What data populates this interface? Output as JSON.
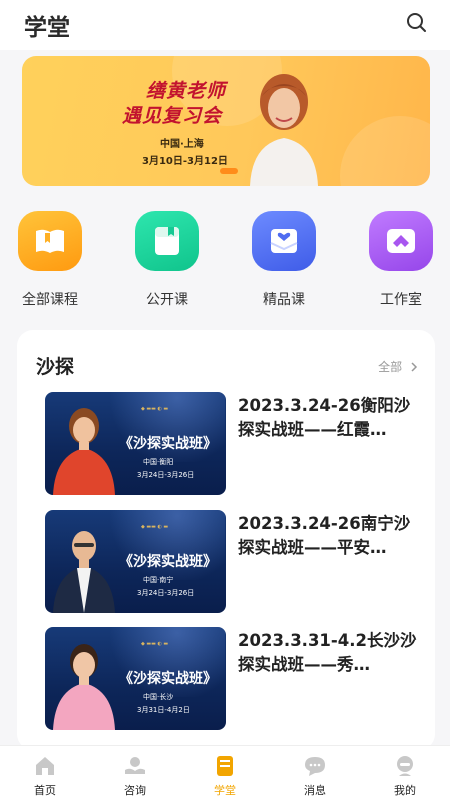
{
  "header": {
    "title": "学堂",
    "search_icon": "search-icon"
  },
  "banner": {
    "line1": "缮黄老师",
    "line2": "遇见复习会",
    "location": "中国·上海",
    "dates": "3月10日-3月12日",
    "colors": {
      "background": "#ffc85a",
      "title": "#c2132f",
      "indicator": "#ff8c1a"
    }
  },
  "quick_nav": [
    {
      "label": "全部课程",
      "icon": "book-icon",
      "color": "#ffa91f"
    },
    {
      "label": "公开课",
      "icon": "notebook-icon",
      "color": "#17d29a"
    },
    {
      "label": "精品课",
      "icon": "heart-mail-icon",
      "color": "#4f6cf0"
    },
    {
      "label": "工作室",
      "icon": "studio-icon",
      "color": "#a856f0"
    }
  ],
  "section": {
    "title": "沙探",
    "more": "全部",
    "more_icon": "chevron-right-icon",
    "courses": [
      {
        "title": "2023.3.24-26衡阳沙探实战班——红霞…",
        "thumb_title": "《沙探实战班》",
        "thumb_loc": "中国·衡阳",
        "thumb_date": "3月24日-3月26日"
      },
      {
        "title": "2023.3.24-26南宁沙探实战班——平安…",
        "thumb_title": "《沙探实战班》",
        "thumb_loc": "中国·南宁",
        "thumb_date": "3月24日-3月26日"
      },
      {
        "title": "2023.3.31-4.2长沙沙探实战班——秀…",
        "thumb_title": "《沙探实战班》",
        "thumb_loc": "中国·长沙",
        "thumb_date": "3月31日-4月2日"
      }
    ]
  },
  "tabbar": {
    "active_color": "#f2a500",
    "items": [
      {
        "label": "首页",
        "icon": "home-icon"
      },
      {
        "label": "咨询",
        "icon": "consult-icon"
      },
      {
        "label": "学堂",
        "icon": "school-icon"
      },
      {
        "label": "消息",
        "icon": "message-icon"
      },
      {
        "label": "我的",
        "icon": "profile-icon"
      }
    ]
  }
}
